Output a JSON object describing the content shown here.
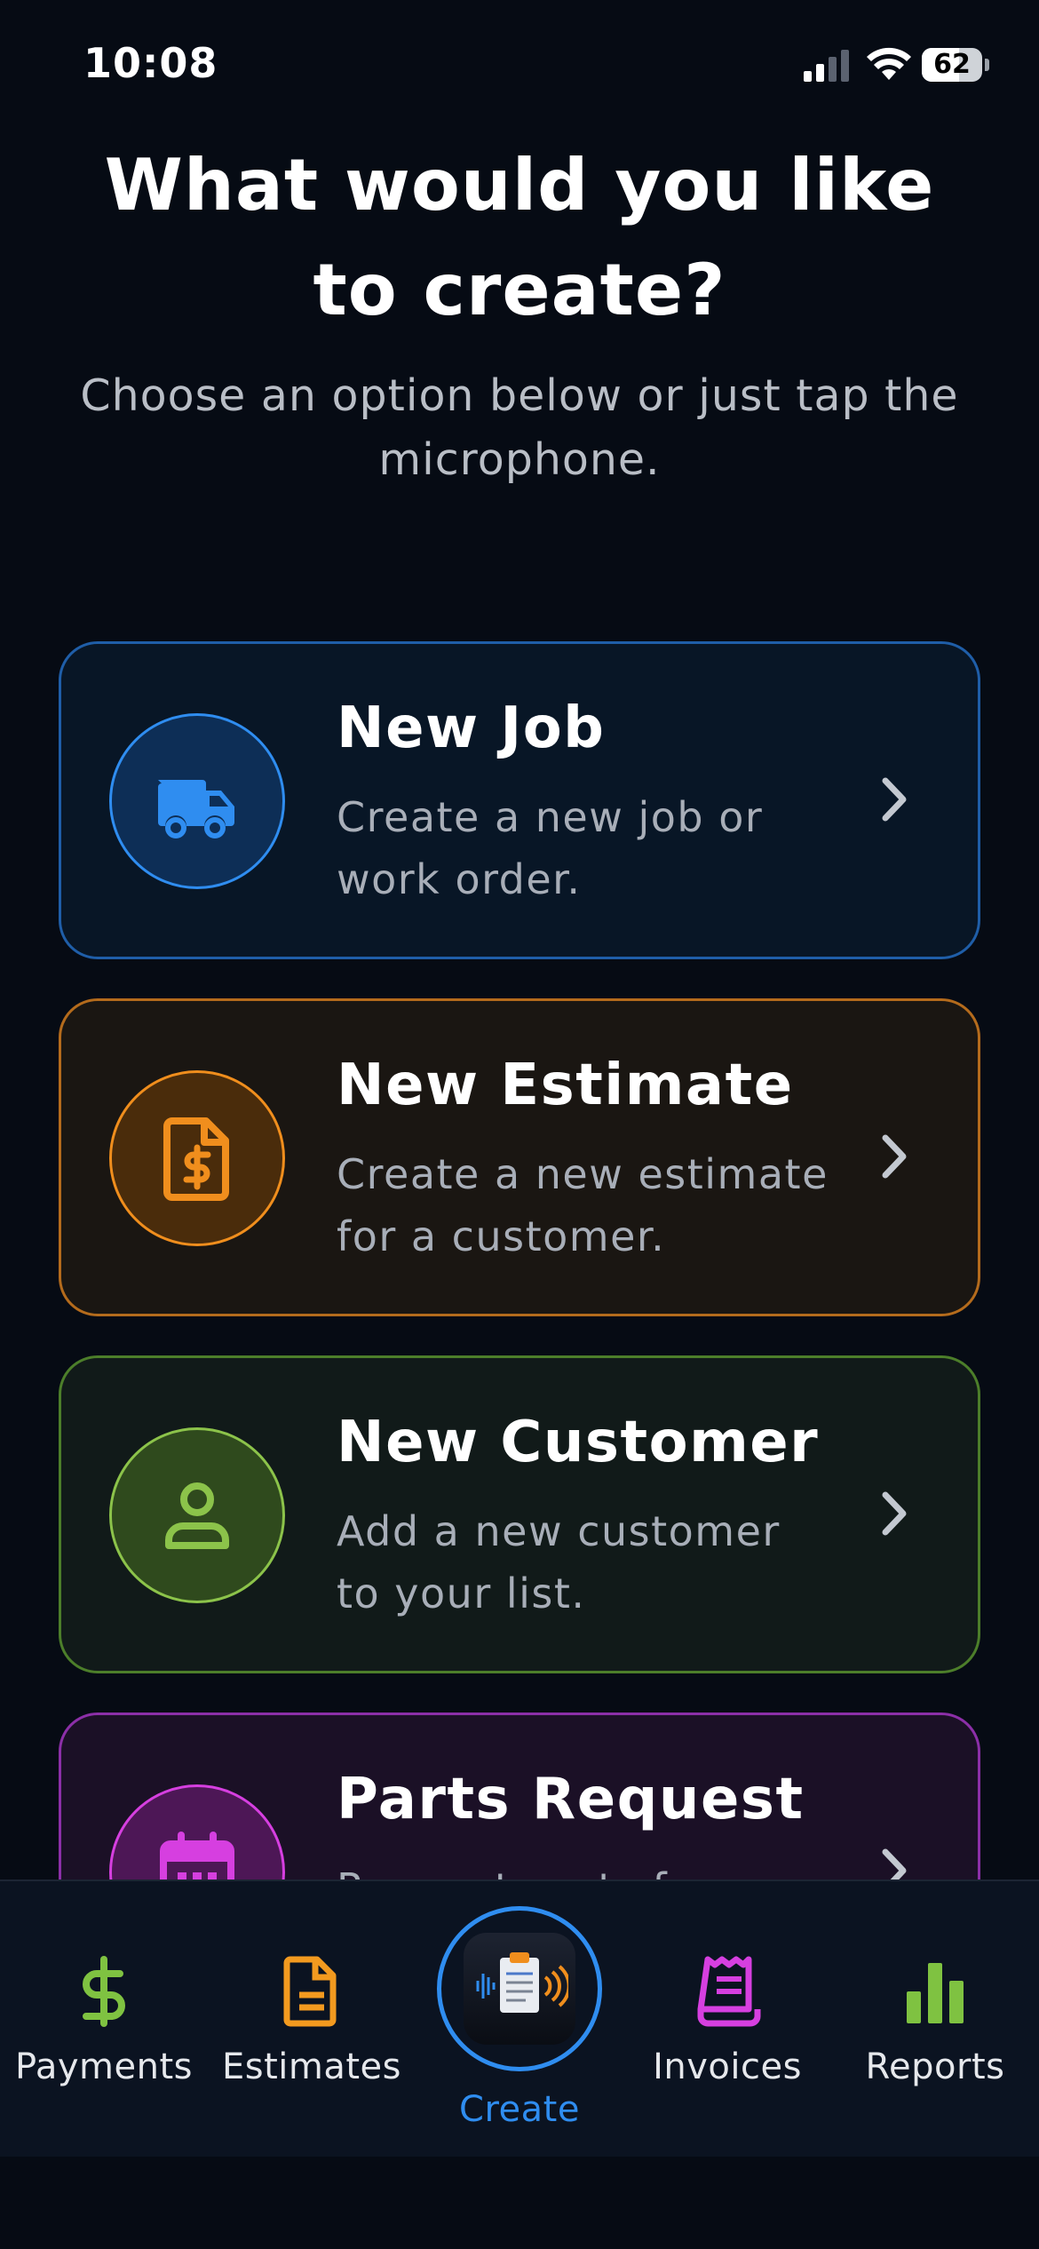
{
  "status_bar": {
    "time": "10:08",
    "battery_percent": "62",
    "battery_level": 0.62
  },
  "header": {
    "title": "What would you like to create?",
    "subtitle": "Choose an option below or just tap the microphone."
  },
  "options": [
    {
      "title": "New Job",
      "description": "Create a new job or work order.",
      "icon": "truck-icon",
      "accent": "#2f8df0"
    },
    {
      "title": "New Estimate",
      "description": "Create a new estimate for a customer.",
      "icon": "file-dollar-icon",
      "accent": "#f08e1d"
    },
    {
      "title": "New Customer",
      "description": "Add a new customer to your list.",
      "icon": "person-icon",
      "accent": "#8cc34a"
    },
    {
      "title": "Parts Request",
      "description": "Request parts for...",
      "icon": "calendar-icon",
      "accent": "#d63fe0"
    }
  ],
  "bottom_nav": {
    "items": [
      {
        "label": "Payments",
        "icon": "dollar-icon",
        "color": "#7fc241"
      },
      {
        "label": "Estimates",
        "icon": "document-icon",
        "color": "#f39a1f"
      },
      {
        "label": "Create",
        "icon": "voice-clipboard-icon",
        "color": "#2f8df0",
        "active": true
      },
      {
        "label": "Invoices",
        "icon": "receipt-icon",
        "color": "#d63fe0"
      },
      {
        "label": "Reports",
        "icon": "bar-chart-icon",
        "color": "#7fc241"
      }
    ]
  }
}
